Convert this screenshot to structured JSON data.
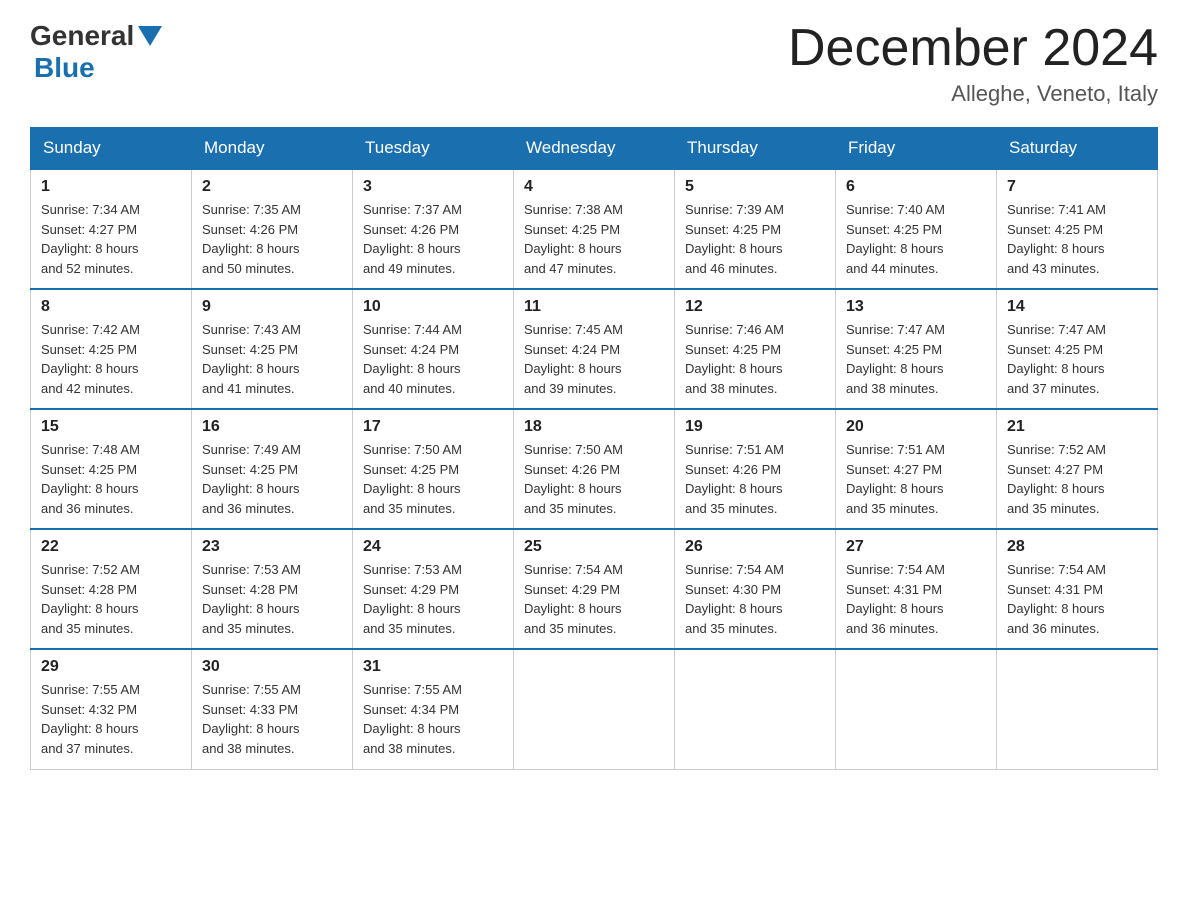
{
  "header": {
    "logo": {
      "general": "General",
      "blue": "Blue"
    },
    "title": "December 2024",
    "location": "Alleghe, Veneto, Italy"
  },
  "columns": [
    "Sunday",
    "Monday",
    "Tuesday",
    "Wednesday",
    "Thursday",
    "Friday",
    "Saturday"
  ],
  "weeks": [
    [
      {
        "num": "1",
        "sunrise": "7:34 AM",
        "sunset": "4:27 PM",
        "daylight": "8 hours and 52 minutes."
      },
      {
        "num": "2",
        "sunrise": "7:35 AM",
        "sunset": "4:26 PM",
        "daylight": "8 hours and 50 minutes."
      },
      {
        "num": "3",
        "sunrise": "7:37 AM",
        "sunset": "4:26 PM",
        "daylight": "8 hours and 49 minutes."
      },
      {
        "num": "4",
        "sunrise": "7:38 AM",
        "sunset": "4:25 PM",
        "daylight": "8 hours and 47 minutes."
      },
      {
        "num": "5",
        "sunrise": "7:39 AM",
        "sunset": "4:25 PM",
        "daylight": "8 hours and 46 minutes."
      },
      {
        "num": "6",
        "sunrise": "7:40 AM",
        "sunset": "4:25 PM",
        "daylight": "8 hours and 44 minutes."
      },
      {
        "num": "7",
        "sunrise": "7:41 AM",
        "sunset": "4:25 PM",
        "daylight": "8 hours and 43 minutes."
      }
    ],
    [
      {
        "num": "8",
        "sunrise": "7:42 AM",
        "sunset": "4:25 PM",
        "daylight": "8 hours and 42 minutes."
      },
      {
        "num": "9",
        "sunrise": "7:43 AM",
        "sunset": "4:25 PM",
        "daylight": "8 hours and 41 minutes."
      },
      {
        "num": "10",
        "sunrise": "7:44 AM",
        "sunset": "4:24 PM",
        "daylight": "8 hours and 40 minutes."
      },
      {
        "num": "11",
        "sunrise": "7:45 AM",
        "sunset": "4:24 PM",
        "daylight": "8 hours and 39 minutes."
      },
      {
        "num": "12",
        "sunrise": "7:46 AM",
        "sunset": "4:25 PM",
        "daylight": "8 hours and 38 minutes."
      },
      {
        "num": "13",
        "sunrise": "7:47 AM",
        "sunset": "4:25 PM",
        "daylight": "8 hours and 38 minutes."
      },
      {
        "num": "14",
        "sunrise": "7:47 AM",
        "sunset": "4:25 PM",
        "daylight": "8 hours and 37 minutes."
      }
    ],
    [
      {
        "num": "15",
        "sunrise": "7:48 AM",
        "sunset": "4:25 PM",
        "daylight": "8 hours and 36 minutes."
      },
      {
        "num": "16",
        "sunrise": "7:49 AM",
        "sunset": "4:25 PM",
        "daylight": "8 hours and 36 minutes."
      },
      {
        "num": "17",
        "sunrise": "7:50 AM",
        "sunset": "4:25 PM",
        "daylight": "8 hours and 35 minutes."
      },
      {
        "num": "18",
        "sunrise": "7:50 AM",
        "sunset": "4:26 PM",
        "daylight": "8 hours and 35 minutes."
      },
      {
        "num": "19",
        "sunrise": "7:51 AM",
        "sunset": "4:26 PM",
        "daylight": "8 hours and 35 minutes."
      },
      {
        "num": "20",
        "sunrise": "7:51 AM",
        "sunset": "4:27 PM",
        "daylight": "8 hours and 35 minutes."
      },
      {
        "num": "21",
        "sunrise": "7:52 AM",
        "sunset": "4:27 PM",
        "daylight": "8 hours and 35 minutes."
      }
    ],
    [
      {
        "num": "22",
        "sunrise": "7:52 AM",
        "sunset": "4:28 PM",
        "daylight": "8 hours and 35 minutes."
      },
      {
        "num": "23",
        "sunrise": "7:53 AM",
        "sunset": "4:28 PM",
        "daylight": "8 hours and 35 minutes."
      },
      {
        "num": "24",
        "sunrise": "7:53 AM",
        "sunset": "4:29 PM",
        "daylight": "8 hours and 35 minutes."
      },
      {
        "num": "25",
        "sunrise": "7:54 AM",
        "sunset": "4:29 PM",
        "daylight": "8 hours and 35 minutes."
      },
      {
        "num": "26",
        "sunrise": "7:54 AM",
        "sunset": "4:30 PM",
        "daylight": "8 hours and 35 minutes."
      },
      {
        "num": "27",
        "sunrise": "7:54 AM",
        "sunset": "4:31 PM",
        "daylight": "8 hours and 36 minutes."
      },
      {
        "num": "28",
        "sunrise": "7:54 AM",
        "sunset": "4:31 PM",
        "daylight": "8 hours and 36 minutes."
      }
    ],
    [
      {
        "num": "29",
        "sunrise": "7:55 AM",
        "sunset": "4:32 PM",
        "daylight": "8 hours and 37 minutes."
      },
      {
        "num": "30",
        "sunrise": "7:55 AM",
        "sunset": "4:33 PM",
        "daylight": "8 hours and 38 minutes."
      },
      {
        "num": "31",
        "sunrise": "7:55 AM",
        "sunset": "4:34 PM",
        "daylight": "8 hours and 38 minutes."
      },
      null,
      null,
      null,
      null
    ]
  ],
  "labels": {
    "sunrise": "Sunrise:",
    "sunset": "Sunset:",
    "daylight": "Daylight:"
  }
}
